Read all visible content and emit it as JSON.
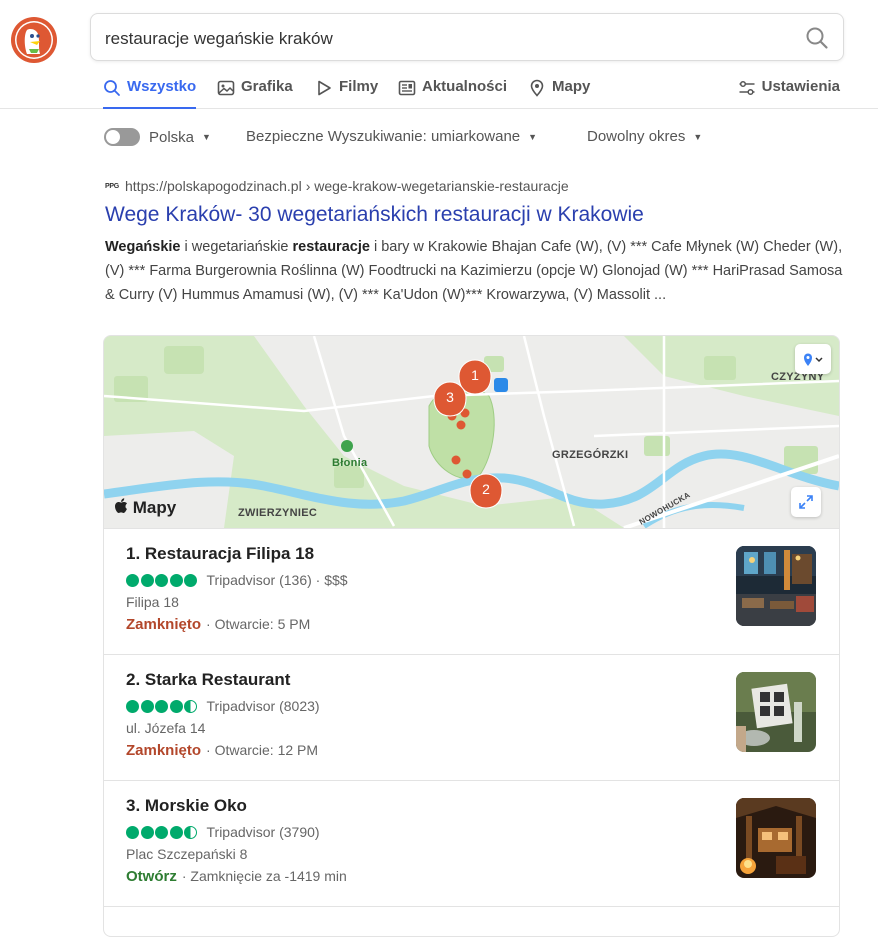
{
  "search": {
    "query": "restauracje wegańskie kraków"
  },
  "tabs": [
    {
      "label": "Wszystko",
      "icon": "search-icon",
      "active": true
    },
    {
      "label": "Grafika",
      "icon": "image-icon"
    },
    {
      "label": "Filmy",
      "icon": "play-icon"
    },
    {
      "label": "Aktualności",
      "icon": "newspaper-icon"
    },
    {
      "label": "Mapy",
      "icon": "map-pin-icon"
    }
  ],
  "settings_label": "Ustawienia",
  "filters": {
    "region": "Polska",
    "safe_search": "Bezpieczne Wyszukiwanie: umiarkowane",
    "time": "Dowolny okres"
  },
  "result": {
    "favicon_text": "PPG",
    "domain": "https://polskapogodzinach.pl",
    "path": "› wege-krakow-wegetarianskie-restauracje",
    "title": "Wege Kraków- 30 wegetariańskich restauracji w Krakowie",
    "snippet_b1": "Wegańskie",
    "snippet_t1": " i wegetariańskie ",
    "snippet_b2": "restauracje",
    "snippet_t2": " i bary w Krakowie Bhajan Cafe (W), (V) *** Cafe Młynek (W) Cheder (W), (V) *** Farma Burgerownia Roślinna (W) Foodtrucki na Kazimierzu (opcje W) Glonojad (W) *** HariPrasad Samosa & Curry (V) Hummus Amamusi (W), (V) *** Ka'Udon (W)*** Krowarzywa, (V) Massolit ..."
  },
  "map": {
    "labels": [
      "CZYŻYNY",
      "GRZEGÓRZKI",
      "Błonia",
      "ZWIERZYNIEC",
      "NOWOHUCKA"
    ],
    "pins": [
      "1",
      "3",
      "2"
    ],
    "brand": "Mapy"
  },
  "places": [
    {
      "name": "1. Restauracja Filipa 18",
      "rating": 5,
      "source": "Tripadvisor (136) · $$$",
      "address": "Filipa 18",
      "status": "Zamknięto",
      "status_type": "closed",
      "status_detail": "· Otwarcie: 5 PM"
    },
    {
      "name": "2. Starka Restaurant",
      "rating": 4.5,
      "source": "Tripadvisor (8023)",
      "address": "ul. Józefa 14",
      "status": "Zamknięto",
      "status_type": "closed",
      "status_detail": "· Otwarcie: 12 PM"
    },
    {
      "name": "3. Morskie Oko",
      "rating": 4.5,
      "source": "Tripadvisor (3790)",
      "address": "Plac Szczepański 8",
      "status": "Otwórz",
      "status_type": "open",
      "status_detail": "· Zamknięcie za -1419 min"
    }
  ],
  "colors": {
    "accent": "#3969ef",
    "link": "#2a3fae",
    "closed": "#b3472b",
    "open": "#2e7d32",
    "rating": "#00aa6c"
  }
}
